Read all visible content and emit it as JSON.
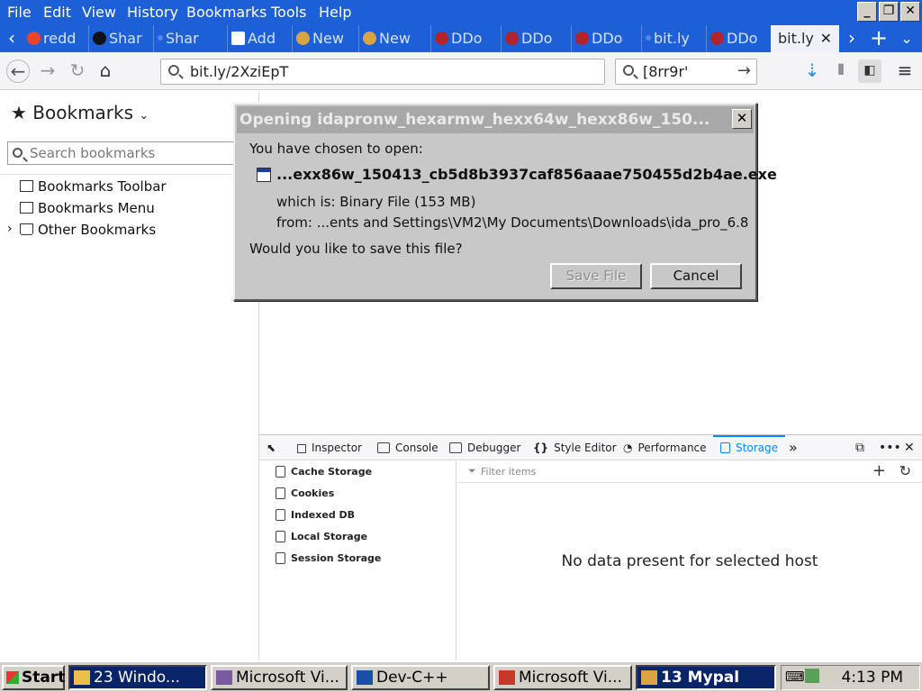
{
  "menubar": {
    "items": [
      "File",
      "Edit",
      "View",
      "History",
      "Bookmarks",
      "Tools",
      "Help"
    ]
  },
  "tabs": [
    {
      "label": "redd",
      "favicon_color": "#e8452b"
    },
    {
      "label": "Shar",
      "favicon_color": "#111111"
    },
    {
      "label": "Shar",
      "favicon_color": "#5a86e6"
    },
    {
      "label": "Add",
      "favicon_color": "#ffffff"
    },
    {
      "label": "New",
      "favicon_color": "#d9a441"
    },
    {
      "label": "New",
      "favicon_color": "#d9a441"
    },
    {
      "label": "DDo",
      "favicon_color": "#b3232b"
    },
    {
      "label": "DDo",
      "favicon_color": "#b3232b"
    },
    {
      "label": "DDo",
      "favicon_color": "#b3232b"
    },
    {
      "label": "bit.ly",
      "favicon_color": "#5a86e6"
    },
    {
      "label": "DDo",
      "favicon_color": "#b3232b"
    },
    {
      "label": "bit.ly",
      "favicon_color": "#ffffff",
      "active": true
    }
  ],
  "navbar": {
    "url": "bit.ly/2XziEpT",
    "search_value": "[8rr9r'"
  },
  "sidebar": {
    "title": "Bookmarks",
    "search_placeholder": "Search bookmarks",
    "items": [
      "Bookmarks Toolbar",
      "Bookmarks Menu",
      "Other Bookmarks"
    ]
  },
  "dialog": {
    "title": "Opening idapronw_hexarmw_hexx64w_hexx86w_150...",
    "chosen_text": "You have chosen to open:",
    "filename": "...exx86w_150413_cb5d8b3937caf856aaae750455d2b4ae.exe",
    "which_is": "which is: Binary File (153 MB)",
    "from": "from: ...ents and Settings\\VM2\\My Documents\\Downloads\\ida_pro_6.8",
    "question": "Would you like to save this file?",
    "save_label": "Save File",
    "cancel_label": "Cancel"
  },
  "devtools": {
    "tabs": [
      "Inspector",
      "Console",
      "Debugger",
      "Style Editor",
      "Performance",
      "Storage"
    ],
    "active_tab": "Storage",
    "storage_nodes": [
      "Cache Storage",
      "Cookies",
      "Indexed DB",
      "Local Storage",
      "Session Storage"
    ],
    "filter_placeholder": "Filter items",
    "empty_message": "No data present for selected host"
  },
  "taskbar": {
    "start_label": "Start",
    "tasks": [
      "23 Windo...",
      "Microsoft Vi...",
      "Dev-C++",
      "Microsoft Vi...",
      "13 Mypal"
    ],
    "clock": "4:13 PM"
  },
  "colors": {
    "titlebar_blue": "#1d5fd6",
    "accent": "#0a84ff",
    "dialog_gray": "#c8c8c8"
  }
}
